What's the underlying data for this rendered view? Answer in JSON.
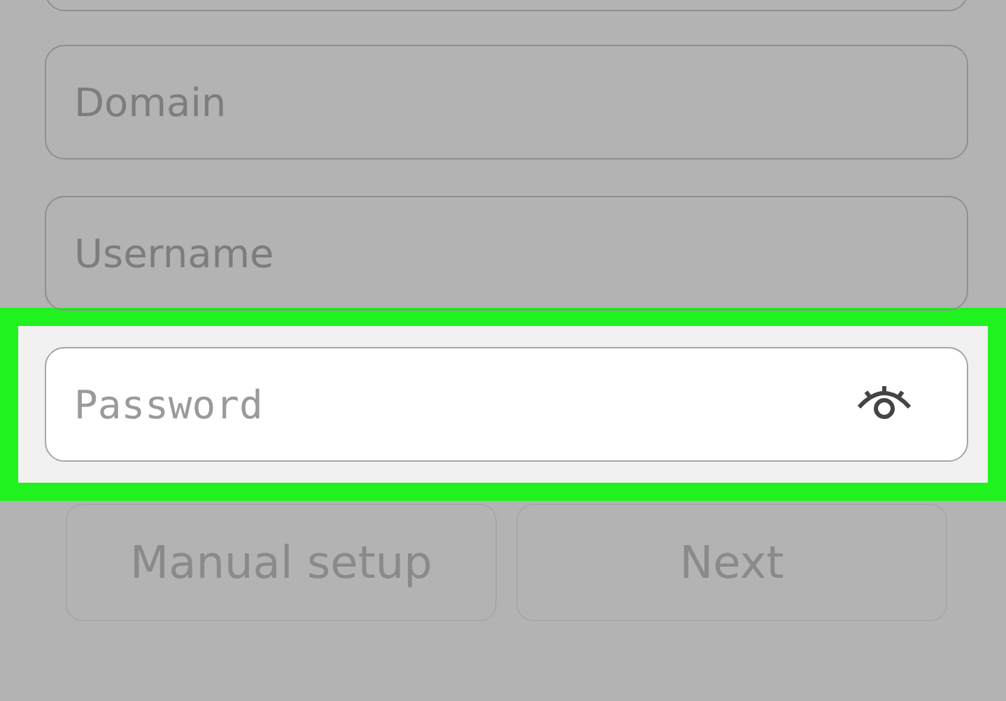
{
  "fields": [
    {
      "kind": "cut"
    },
    {
      "kind": "text",
      "placeholder": "Domain",
      "highlighted": false
    },
    {
      "kind": "text",
      "placeholder": "Username",
      "highlighted": false
    },
    {
      "kind": "password",
      "placeholder": "Password",
      "highlighted": true
    }
  ],
  "buttons": [
    {
      "label": "Manual setup"
    },
    {
      "label": "Next"
    }
  ]
}
